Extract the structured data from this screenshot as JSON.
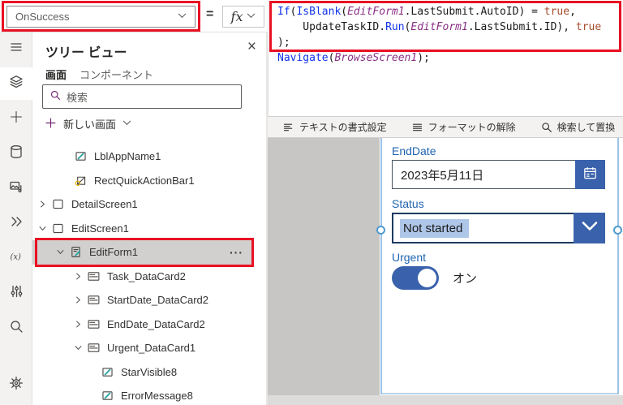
{
  "colors": {
    "annotation_red": "#e81123",
    "brand_purple": "#742774",
    "control_blue": "#3a62ac",
    "selection_blue": "#9cc3e8",
    "field_label_blue": "#2065b1"
  },
  "topbar": {
    "property_selector_value": "OnSuccess",
    "equals_sign": "=",
    "fx_label": "fx"
  },
  "formula": {
    "lines": [
      [
        {
          "t": "If",
          "c": "fn"
        },
        {
          "t": "(",
          "c": "pl"
        },
        {
          "t": "IsBlank",
          "c": "fn"
        },
        {
          "t": "(",
          "c": "pl"
        },
        {
          "t": "EditForm1",
          "c": "ctrl"
        },
        {
          "t": ".LastSubmit.AutoID",
          "c": "pl"
        },
        {
          "t": ") = ",
          "c": "pl"
        },
        {
          "t": "true",
          "c": "bool"
        },
        {
          "t": ",",
          "c": "pl"
        }
      ],
      [
        {
          "t": "    UpdateTaskID.",
          "c": "pl"
        },
        {
          "t": "Run",
          "c": "fn"
        },
        {
          "t": "(",
          "c": "pl"
        },
        {
          "t": "EditForm1",
          "c": "ctrl"
        },
        {
          "t": ".LastSubmit.ID",
          "c": "pl"
        },
        {
          "t": "), ",
          "c": "pl"
        },
        {
          "t": "true",
          "c": "bool"
        }
      ],
      [
        {
          "t": ");",
          "c": "pl"
        }
      ],
      [
        {
          "t": "Navigate",
          "c": "fn"
        },
        {
          "t": "(",
          "c": "pl"
        },
        {
          "t": "BrowseScreen1",
          "c": "ctrl"
        },
        {
          "t": ");",
          "c": "pl"
        }
      ]
    ]
  },
  "formula_toolbar": {
    "items": [
      {
        "label": "テキストの書式設定",
        "icon": "format-text-icon"
      },
      {
        "label": "フォーマットの解除",
        "icon": "clear-format-icon"
      },
      {
        "label": "検索して置換",
        "icon": "search-replace-icon"
      }
    ]
  },
  "left_rail": {
    "items": [
      {
        "icon": "menu-icon",
        "active": false
      },
      {
        "icon": "tree-view-icon",
        "active": true
      },
      {
        "icon": "plus-icon",
        "active": false
      },
      {
        "icon": "data-icon",
        "active": false
      },
      {
        "icon": "media-icon",
        "active": false
      },
      {
        "icon": "flow-icon",
        "active": false
      },
      {
        "icon": "variables-icon",
        "active": false
      },
      {
        "icon": "tools-icon",
        "active": false
      },
      {
        "icon": "search-icon",
        "active": false
      }
    ],
    "bottom_items": [
      {
        "icon": "settings-icon",
        "active": false
      }
    ]
  },
  "tree_panel": {
    "title": "ツリー ビュー",
    "close_glyph": "×",
    "tabs": [
      {
        "label": "画面",
        "active": true
      },
      {
        "label": "コンポーネント",
        "active": false
      }
    ],
    "search_placeholder": "検索",
    "new_screen_label": "新しい画面",
    "row_ellipsis": "···",
    "items": [
      {
        "label": "",
        "icon": "label-icon",
        "indent": "child",
        "partial": true
      },
      {
        "label": "LblAppName1",
        "icon": "label-icon",
        "indent": "child"
      },
      {
        "label": "RectQuickActionBar1",
        "icon": "shape-icon",
        "indent": "child"
      },
      {
        "label": "DetailScreen1",
        "icon": "screen-icon",
        "chevron": "right",
        "indent": "screen"
      },
      {
        "label": "EditScreen1",
        "icon": "screen-icon",
        "chevron": "down",
        "indent": "screen"
      },
      {
        "label": "EditForm1",
        "icon": "form-icon",
        "chevron": "down",
        "indent": "form",
        "selected": true,
        "annotated": true,
        "ellipsis": true
      },
      {
        "label": "Task_DataCard2",
        "icon": "datacard-icon",
        "chevron": "right",
        "indent": "card"
      },
      {
        "label": "StartDate_DataCard2",
        "icon": "datacard-icon",
        "chevron": "right",
        "indent": "card"
      },
      {
        "label": "EndDate_DataCard2",
        "icon": "datacard-icon",
        "chevron": "right",
        "indent": "card"
      },
      {
        "label": "Urgent_DataCard1",
        "icon": "datacard-icon",
        "chevron": "down",
        "indent": "card"
      },
      {
        "label": "StarVisible8",
        "icon": "label-icon",
        "indent": "cardchild"
      },
      {
        "label": "ErrorMessage8",
        "icon": "label-icon",
        "indent": "cardchild"
      }
    ]
  },
  "canvas": {
    "fields": {
      "end_date": {
        "label": "EndDate",
        "value": "2023年5月11日"
      },
      "status": {
        "label": "Status",
        "value": "Not started"
      },
      "urgent": {
        "label": "Urgent",
        "value": "オン",
        "state": "on"
      }
    }
  }
}
